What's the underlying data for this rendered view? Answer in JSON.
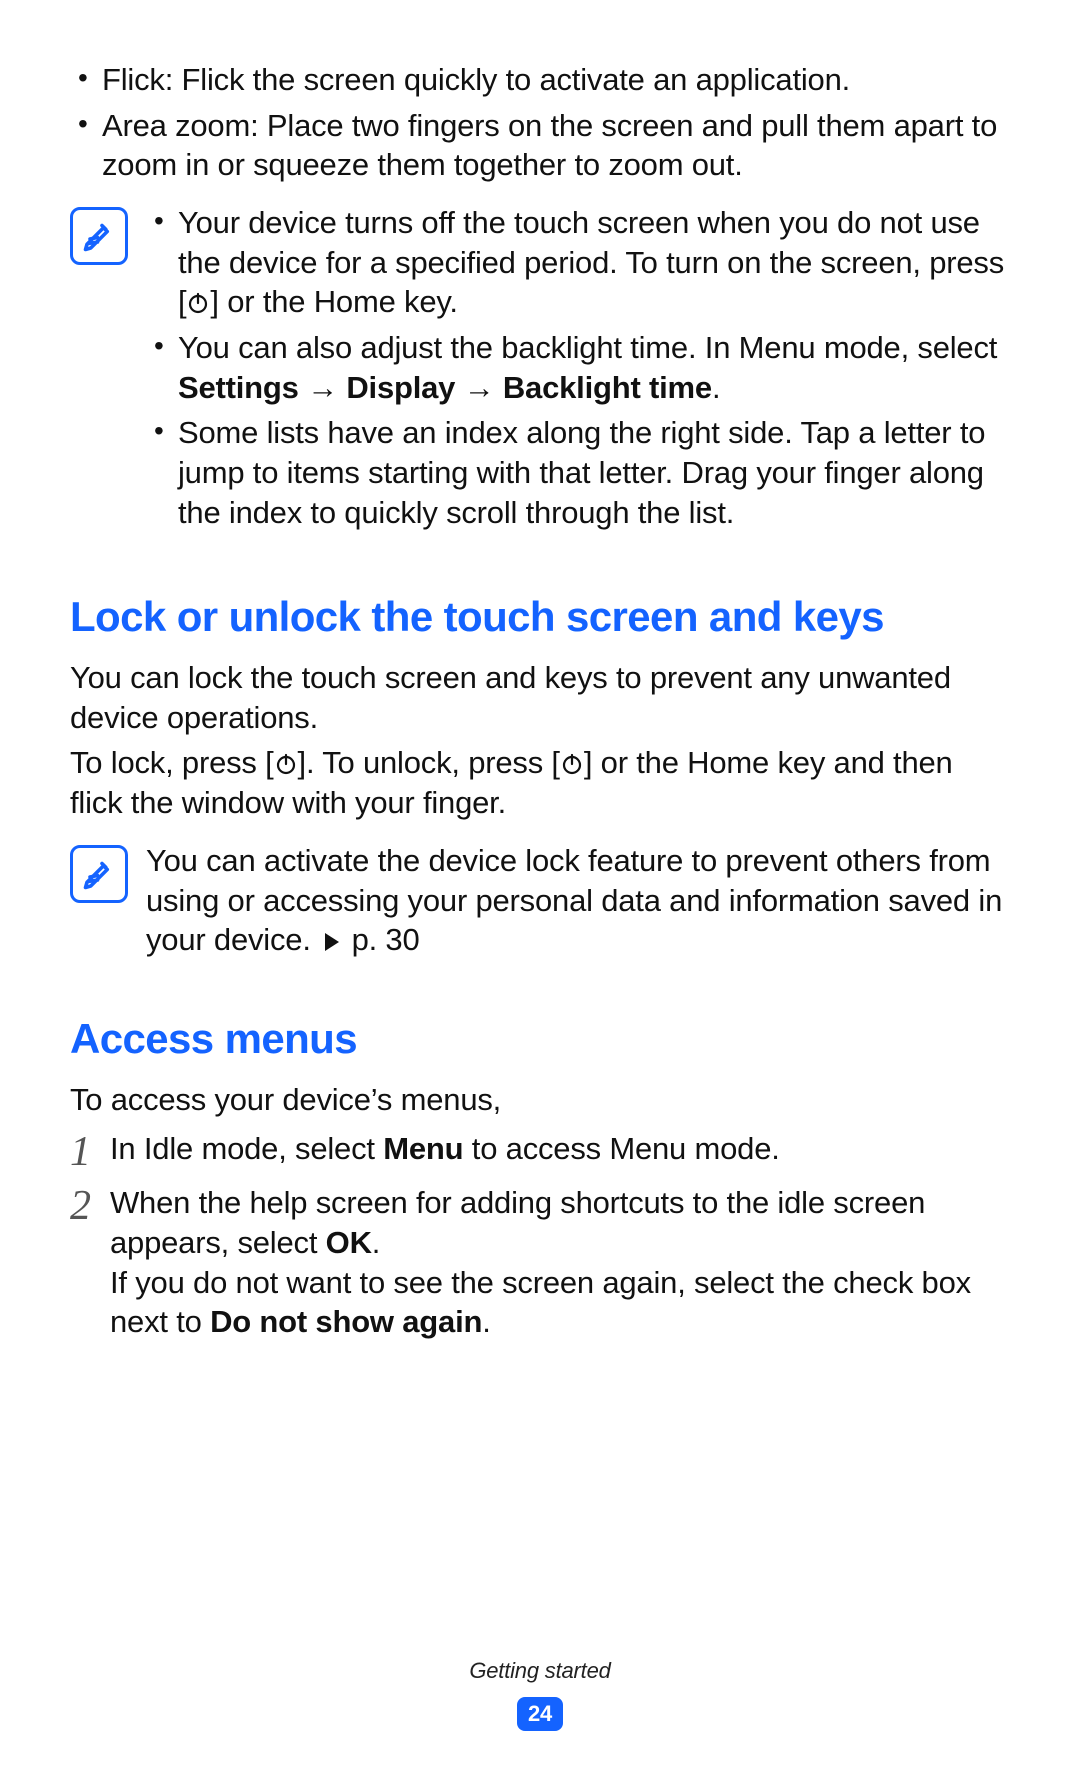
{
  "top_bullets": [
    "Flick: Flick the screen quickly to activate an application.",
    "Area zoom: Place two fingers on the screen and pull them apart to zoom in or squeeze them together to zoom out."
  ],
  "note1": {
    "b1_pre": "Your device turns off the touch screen when you do not use the device for a specified period. To turn on the screen, press [",
    "b1_post": "] or the Home key.",
    "b2_pre": "You can also adjust the backlight time. In Menu mode, select ",
    "b2_settings": "Settings",
    "b2_display": "Display",
    "b2_backlight": "Backlight time",
    "b3": "Some lists have an index along the right side. Tap a letter to jump to items starting with that letter. Drag your finger along the index to quickly scroll through the list."
  },
  "lock_heading": "Lock or unlock the touch screen and keys",
  "lock_p1": "You can lock the touch screen and keys to prevent any unwanted device operations.",
  "lock_p2_a": "To lock, press [",
  "lock_p2_b": "]. To unlock, press [",
  "lock_p2_c": "] or the Home key and then flick the window with your finger.",
  "note2_pre": "You can activate the device lock feature to prevent others from using or accessing your personal data and information saved in your device. ",
  "note2_ref": " p. 30",
  "access_heading": "Access menus",
  "access_intro": "To access your device’s menus,",
  "step1_a": "In Idle mode, select ",
  "step1_menu": "Menu",
  "step1_b": " to access Menu mode.",
  "step2_a": "When the help screen for adding shortcuts to the idle screen appears, select ",
  "step2_ok": "OK",
  "step2_b": ".",
  "step2_c": "If you do not want to see the screen again, select the check box next to ",
  "step2_dns": "Do not show again",
  "step2_d": ".",
  "footer_label": "Getting started",
  "page_number": "24"
}
